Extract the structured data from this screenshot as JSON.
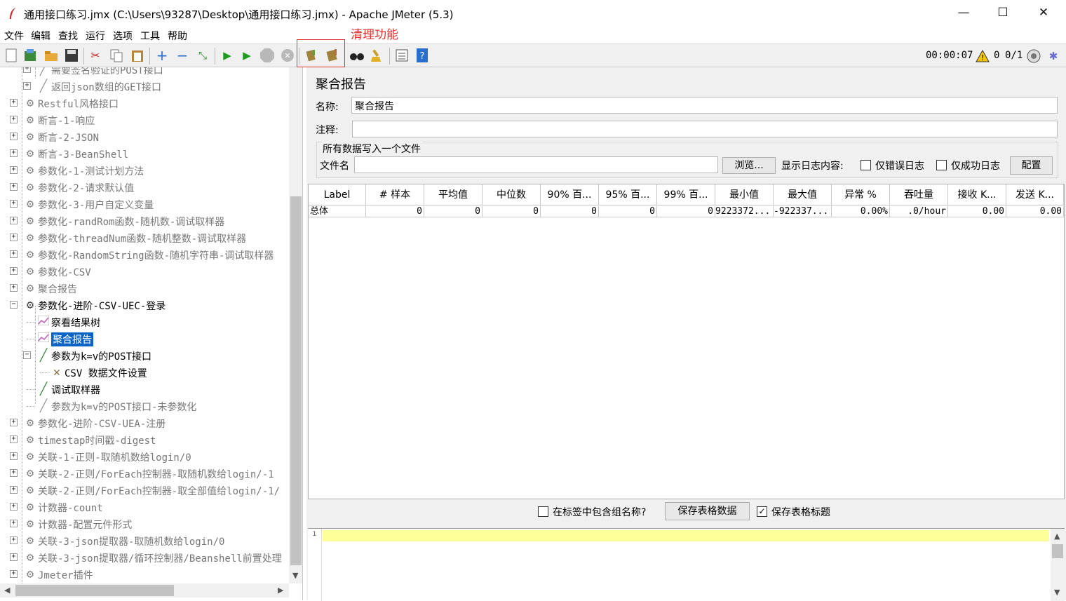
{
  "window": {
    "title": "通用接口练习.jmx (C:\\Users\\93287\\Desktop\\通用接口练习.jmx) - Apache JMeter (5.3)",
    "minimize": "—",
    "maximize": "☐",
    "close": "✕"
  },
  "menu": [
    "文件",
    "编辑",
    "查找",
    "运行",
    "选项",
    "工具",
    "帮助"
  ],
  "annotation": "清理功能",
  "toolbar": {
    "elapsed": "00:00:07",
    "warning_count": "0",
    "threads": "0/1",
    "icons": [
      "new-icon",
      "templates-icon",
      "open-icon",
      "save-icon",
      "cut-icon",
      "copy-icon",
      "paste-icon",
      "expand-icon",
      "collapse-icon",
      "toggle-icon",
      "start-icon",
      "start-no-pause-icon",
      "stop-icon",
      "shutdown-icon",
      "clear-icon",
      "clear-all-icon",
      "search-icon",
      "reset-search-icon",
      "function-helper-icon",
      "help-icon"
    ]
  },
  "tree": [
    {
      "label": "需要签名验证的POST接口",
      "indent": 2,
      "icon": "sampler",
      "toggle": "+",
      "disabled": true
    },
    {
      "label": "返回json数组的GET接口",
      "indent": 2,
      "icon": "sampler",
      "toggle": "+",
      "disabled": true
    },
    {
      "label": "Restful风格接口",
      "indent": 1,
      "icon": "gear",
      "toggle": "+",
      "disabled": true
    },
    {
      "label": "断言-1-响应",
      "indent": 1,
      "icon": "gear",
      "toggle": "+",
      "disabled": true
    },
    {
      "label": "断言-2-JSON",
      "indent": 1,
      "icon": "gear",
      "toggle": "+",
      "disabled": true
    },
    {
      "label": "断言-3-BeanShell",
      "indent": 1,
      "icon": "gear",
      "toggle": "+",
      "disabled": true
    },
    {
      "label": "参数化-1-测试计划方法",
      "indent": 1,
      "icon": "gear",
      "toggle": "+",
      "disabled": true
    },
    {
      "label": "参数化-2-请求默认值",
      "indent": 1,
      "icon": "gear",
      "toggle": "+",
      "disabled": true
    },
    {
      "label": "参数化-3-用户自定义变量",
      "indent": 1,
      "icon": "gear",
      "toggle": "+",
      "disabled": true
    },
    {
      "label": "参数化-randRom函数-随机数-调试取样器",
      "indent": 1,
      "icon": "gear",
      "toggle": "+",
      "disabled": true
    },
    {
      "label": "参数化-threadNum函数-随机整数-调试取样器",
      "indent": 1,
      "icon": "gear",
      "toggle": "+",
      "disabled": true
    },
    {
      "label": "参数化-RandomString函数-随机字符串-调试取样器",
      "indent": 1,
      "icon": "gear",
      "toggle": "+",
      "disabled": true
    },
    {
      "label": "参数化-CSV",
      "indent": 1,
      "icon": "gear",
      "toggle": "+",
      "disabled": true
    },
    {
      "label": "聚合报告",
      "indent": 1,
      "icon": "gear",
      "toggle": "+",
      "disabled": true
    },
    {
      "label": "参数化-进阶-CSV-UEC-登录",
      "indent": 1,
      "icon": "gear-active",
      "toggle": "−",
      "disabled": false
    },
    {
      "label": "察看结果树",
      "indent": 2,
      "icon": "listener",
      "toggle": "",
      "disabled": false
    },
    {
      "label": "聚合报告",
      "indent": 2,
      "icon": "listener",
      "toggle": "",
      "disabled": false,
      "selected": true
    },
    {
      "label": "参数为k=v的POST接口",
      "indent": 2,
      "icon": "sampler-active",
      "toggle": "−",
      "disabled": false
    },
    {
      "label": "CSV 数据文件设置",
      "indent": 3,
      "icon": "config",
      "toggle": "",
      "disabled": false
    },
    {
      "label": "调试取样器",
      "indent": 2,
      "icon": "sampler-active",
      "toggle": "",
      "disabled": false
    },
    {
      "label": "参数为k=v的POST接口-未参数化",
      "indent": 2,
      "icon": "sampler",
      "toggle": "",
      "disabled": true
    },
    {
      "label": "参数化-进阶-CSV-UEA-注册",
      "indent": 1,
      "icon": "gear",
      "toggle": "+",
      "disabled": true
    },
    {
      "label": "timestap时间戳-digest",
      "indent": 1,
      "icon": "gear",
      "toggle": "+",
      "disabled": true
    },
    {
      "label": "关联-1-正则-取随机数给login/0",
      "indent": 1,
      "icon": "gear",
      "toggle": "+",
      "disabled": true
    },
    {
      "label": "关联-2-正则/ForEach控制器-取随机数给login/-1",
      "indent": 1,
      "icon": "gear",
      "toggle": "+",
      "disabled": true
    },
    {
      "label": "关联-2-正则/ForEach控制器-取全部值给login/-1/",
      "indent": 1,
      "icon": "gear",
      "toggle": "+",
      "disabled": true
    },
    {
      "label": "计数器-count",
      "indent": 1,
      "icon": "gear",
      "toggle": "+",
      "disabled": true
    },
    {
      "label": "计数器-配置元件形式",
      "indent": 1,
      "icon": "gear",
      "toggle": "+",
      "disabled": true
    },
    {
      "label": "关联-3-json提取器-取随机数给login/0",
      "indent": 1,
      "icon": "gear",
      "toggle": "+",
      "disabled": true
    },
    {
      "label": "关联-3-json提取器/循环控制器/Beanshell前置处理",
      "indent": 1,
      "icon": "gear",
      "toggle": "+",
      "disabled": true
    },
    {
      "label": "Jmeter插件",
      "indent": 1,
      "icon": "gear",
      "toggle": "+",
      "disabled": true
    }
  ],
  "report": {
    "title": "聚合报告",
    "name_label": "名称:",
    "name_value": "聚合报告",
    "comment_label": "注释:",
    "comment_value": "",
    "file_group_title": "所有数据写入一个文件",
    "file_label": "文件名",
    "file_value": "",
    "browse_button": "浏览...",
    "log_content_label": "显示日志内容:",
    "errors_only_label": "仅错误日志",
    "errors_only_checked": false,
    "success_only_label": "仅成功日志",
    "success_only_checked": false,
    "configure_button": "配置"
  },
  "table": {
    "columns": [
      "Label",
      "# 样本",
      "平均值",
      "中位数",
      "90% 百...",
      "95% 百...",
      "99% 百...",
      "最小值",
      "最大值",
      "异常 %",
      "吞吐量",
      "接收 K...",
      "发送 K..."
    ],
    "rows": [
      [
        "总体",
        "0",
        "0",
        "0",
        "0",
        "0",
        "0",
        "9223372...",
        "-922337...",
        "0.00%",
        ".0/hour",
        "0.00",
        "0.00"
      ]
    ]
  },
  "bottom": {
    "include_group_label": "在标签中包含组名称?",
    "include_group_checked": false,
    "save_table_button": "保存表格数据",
    "save_header_label": "保存表格标题",
    "save_header_checked": true
  },
  "editor": {
    "line_number": "1",
    "content": ""
  }
}
